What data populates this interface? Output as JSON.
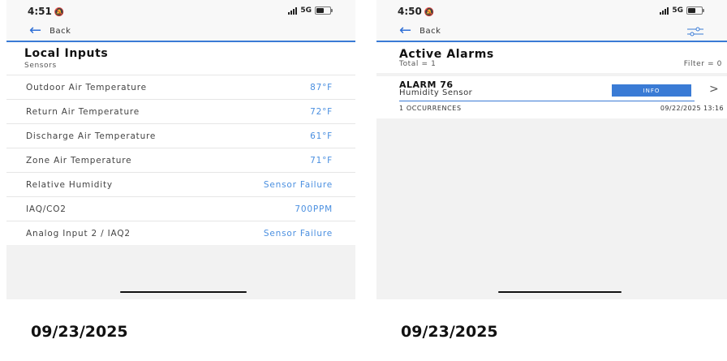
{
  "left_screen": {
    "status": {
      "time": "4:51",
      "network": "5G"
    },
    "nav": {
      "back_label": "Back"
    },
    "header": {
      "title": "Local Inputs",
      "subtitle": "Sensors"
    },
    "rows": [
      {
        "label": "Outdoor Air Temperature",
        "value": "87°F"
      },
      {
        "label": "Return Air Temperature",
        "value": "72°F"
      },
      {
        "label": "Discharge Air Temperature",
        "value": "61°F"
      },
      {
        "label": "Zone Air Temperature",
        "value": "71°F"
      },
      {
        "label": "Relative Humidity",
        "value": "Sensor Failure"
      },
      {
        "label": "IAQ/CO2",
        "value": "700PPM"
      },
      {
        "label": "Analog Input 2 / IAQ2",
        "value": "Sensor Failure"
      }
    ],
    "date_stamp": "09/23/2025"
  },
  "right_screen": {
    "status": {
      "time": "4:50",
      "network": "5G"
    },
    "nav": {
      "back_label": "Back"
    },
    "header": {
      "title": "Active Alarms",
      "total": "Total = 1",
      "filter": "Filter = 0"
    },
    "alarm": {
      "name": "ALARM 76",
      "description": "Humidity Sensor",
      "badge": "INFO",
      "chevron": ">",
      "occurrences": "1 OCCURRENCES",
      "timestamp": "09/22/2025 13:16"
    },
    "date_stamp": "09/23/2025"
  },
  "colors": {
    "accent": "#3a7bd5",
    "value_text": "#4a8fe0",
    "background": "#f2f2f2"
  },
  "icons": [
    "back-arrow-icon",
    "mute-bell-icon",
    "signal-icon",
    "battery-icon",
    "filter-sliders-icon",
    "chevron-right-icon"
  ]
}
